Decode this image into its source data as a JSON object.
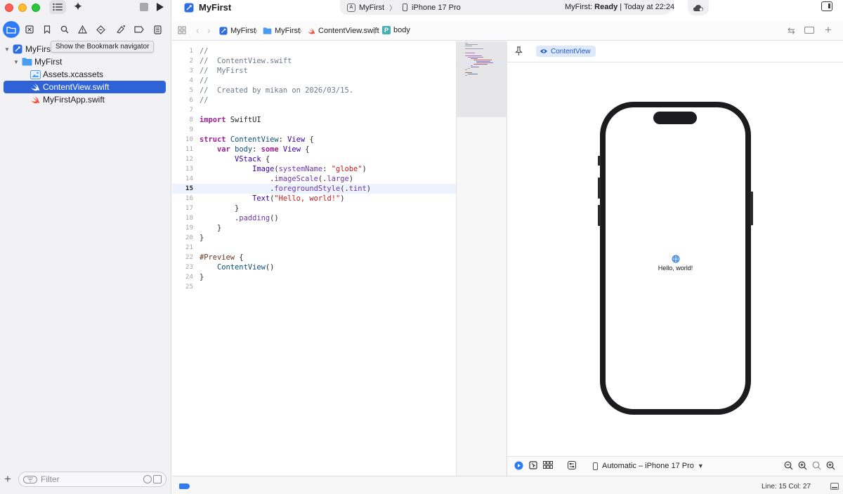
{
  "window": {
    "project_title": "MyFirst"
  },
  "toolbar": {
    "scheme": "MyFirst",
    "destination": "iPhone 17 Pro",
    "status_project": "MyFirst:",
    "status_state": "Ready",
    "status_time": "| Today at 22:24"
  },
  "navigator": {
    "tooltip": "Show the Bookmark navigator",
    "icons": [
      "project-navigator-icon",
      "source-control-icon",
      "bookmark-icon",
      "find-icon",
      "issue-icon",
      "test-icon",
      "debug-icon",
      "breakpoint-icon",
      "report-icon"
    ],
    "tree": [
      {
        "label": "MyFirst",
        "icon": "project-icon",
        "level": 0,
        "expanded": true
      },
      {
        "label": "MyFirst",
        "icon": "folder-icon",
        "level": 1,
        "expanded": true
      },
      {
        "label": "Assets.xcassets",
        "icon": "assets-icon",
        "level": 2
      },
      {
        "label": "ContentView.swift",
        "icon": "swift-file-icon",
        "level": 2,
        "selected": true
      },
      {
        "label": "MyFirstApp.swift",
        "icon": "swift-file-icon",
        "level": 2
      }
    ],
    "filter_placeholder": "Filter"
  },
  "jumpbar": {
    "crumbs": [
      {
        "label": "MyFirst",
        "icon": "project-icon"
      },
      {
        "label": "MyFirst",
        "icon": "folder-icon"
      },
      {
        "label": "ContentView.swift",
        "icon": "swift-file-icon"
      },
      {
        "label": "body",
        "icon": "property-icon",
        "badge": "P"
      }
    ]
  },
  "editor": {
    "current_line": 15,
    "lines": [
      "//",
      "//  ContentView.swift",
      "//  MyFirst",
      "//",
      "//  Created by mikan on 2026/03/15.",
      "//",
      "",
      "import SwiftUI",
      "",
      "struct ContentView: View {",
      "    var body: some View {",
      "        VStack {",
      "            Image(systemName: \"globe\")",
      "                .imageScale(.large)",
      "                .foregroundStyle(.tint)",
      "            Text(\"Hello, world!\")",
      "        }",
      "        .padding()",
      "    }",
      "}",
      "",
      "#Preview {",
      "    ContentView()",
      "}",
      ""
    ]
  },
  "canvas": {
    "preview_label": "ContentView",
    "preview_text": "Hello, world!",
    "device_picker": "Automatic – iPhone 17 Pro"
  },
  "statusbar": {
    "cursor": "Line: 15  Col: 27"
  },
  "colors": {
    "accent": "#2f7bf6",
    "selection": "#2f62d6",
    "swift_orange": "#f05138",
    "folder_blue": "#4a9cf0"
  }
}
